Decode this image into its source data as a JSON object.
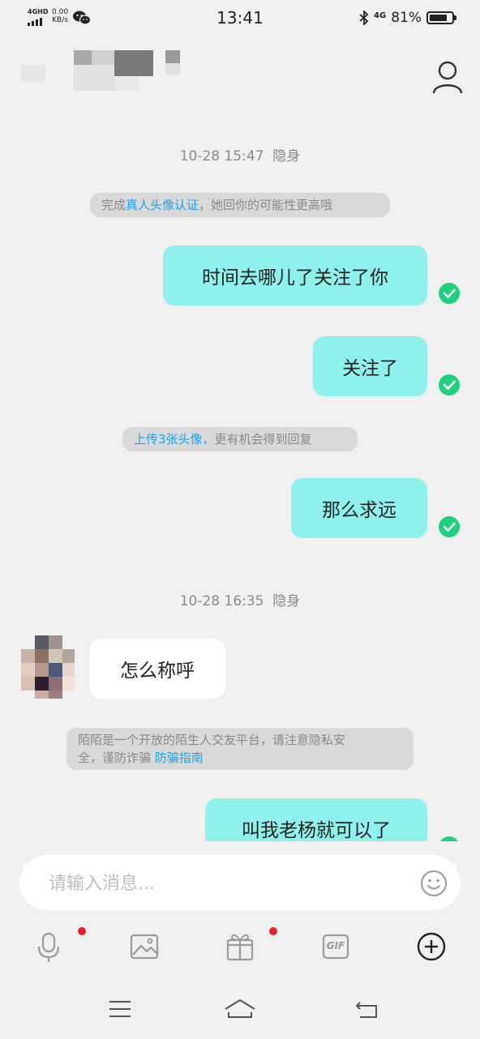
{
  "status_bar": {
    "network": "4GHD",
    "speed_value": "0.00",
    "speed_unit": "KB/s",
    "time": "13:41",
    "cellular": "4G",
    "battery": "81%",
    "battery_level": 0.81
  },
  "header": {
    "contact_name": "",
    "icons": {
      "profile": "person-icon"
    }
  },
  "messages": {
    "ts1": "10-28 15:47",
    "ts1_status": "隐身",
    "notice1_prefix": "完成",
    "notice1_link": "真人头像认证",
    "notice1_suffix": "，她回你的可能性更高哦",
    "out1": "时间去哪儿了关注了你",
    "out2": "关注了",
    "notice2_link": "上传3张头像，",
    "notice2_suffix": "更有机会得到回复",
    "out3": "那么求远",
    "ts2": "10-28 16:35",
    "ts2_status": "隐身",
    "in1": "怎么称呼",
    "notice3_line1": "陌陌是一个开放的陌生人交友平台，请注意隐私安",
    "notice3_line2": "全，谨防诈骗",
    "notice3_link": "防骗指南",
    "out4": "叫我老杨就可以了"
  },
  "input": {
    "placeholder": "请输入消息...",
    "value": ""
  },
  "toolbar": {
    "icons": [
      "microphone-icon",
      "image-icon",
      "gift-icon",
      "gif-icon",
      "plus-icon"
    ],
    "gif_label": "GIF"
  },
  "colors": {
    "outgoing_bubble": "#8ef1ec",
    "incoming_bubble": "#ffffff",
    "read_check": "#1fd17e",
    "link": "#1aa3e8",
    "badge": "#e8202a"
  }
}
